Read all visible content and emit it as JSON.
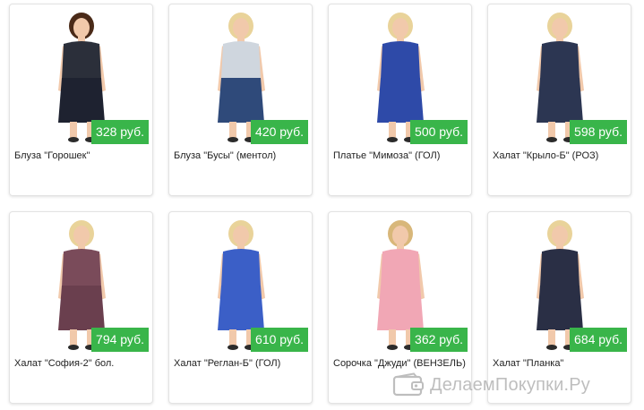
{
  "products": [
    {
      "title": "Блуза \"Горошек\"",
      "price": "328 руб.",
      "top_color": "#2b2f3a",
      "bottom_color": "#1e2230",
      "hair": "#4a2a18",
      "skin": "#f1c9ab"
    },
    {
      "title": "Блуза \"Бусы\" (ментол)",
      "price": "420 руб.",
      "top_color": "#cfd6de",
      "bottom_color": "#2f4a7a",
      "hair": "#e9d39a",
      "skin": "#f1c9ab"
    },
    {
      "title": "Платье \"Мимоза\" (ГОЛ)",
      "price": "500 руб.",
      "top_color": "#2e4aa8",
      "bottom_color": "#2e4aa8",
      "hair": "#e9d39a",
      "skin": "#f1c9ab"
    },
    {
      "title": "Халат \"Крыло-Б\" (РОЗ)",
      "price": "598 руб.",
      "top_color": "#2c3652",
      "bottom_color": "#2c3652",
      "hair": "#e9d39a",
      "skin": "#f1c9ab"
    },
    {
      "title": "Халат \"София-2\" бол.",
      "price": "794 руб.",
      "top_color": "#7a4b5a",
      "bottom_color": "#6a3f4e",
      "hair": "#e9d39a",
      "skin": "#f1c9ab"
    },
    {
      "title": "Халат \"Реглан-Б\" (ГОЛ)",
      "price": "610 руб.",
      "top_color": "#3b5fc7",
      "bottom_color": "#3b5fc7",
      "hair": "#e9d39a",
      "skin": "#f1c9ab"
    },
    {
      "title": "Сорочка \"Джуди\" (ВЕНЗЕЛЬ)",
      "price": "362 руб.",
      "top_color": "#f1a7b5",
      "bottom_color": "#f1a7b5",
      "hair": "#d8b77a",
      "skin": "#f1c9ab"
    },
    {
      "title": "Халат \"Планка\"",
      "price": "684 руб.",
      "top_color": "#2a2f45",
      "bottom_color": "#2a2f45",
      "hair": "#e9d39a",
      "skin": "#f1c9ab"
    }
  ],
  "watermark": {
    "text": "ДелаемПокупки.Ру",
    "icon": "wallet-icon"
  },
  "colors": {
    "price_badge": "#39b54a",
    "card_border": "#e3e3e3"
  }
}
